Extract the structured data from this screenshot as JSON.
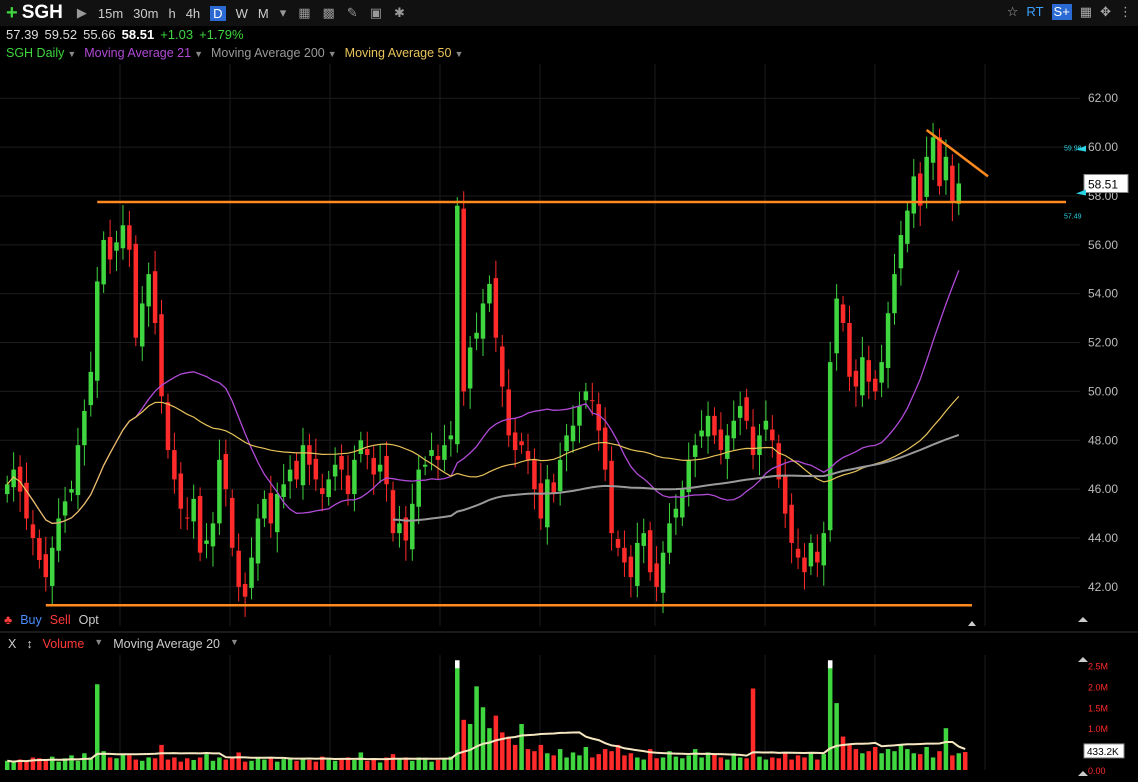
{
  "toolbar": {
    "symbol": "SGH",
    "timeframes": [
      "15m",
      "30m",
      "h",
      "4h",
      "D",
      "W",
      "M"
    ],
    "active_timeframe": "D",
    "right_icons": [
      "star-icon",
      "rt-icon",
      "share-icon",
      "save-icon",
      "move-icon",
      "more-icon"
    ],
    "rt_label": "RT",
    "share_label": "S+"
  },
  "quote": {
    "open": "57.39",
    "high": "59.52",
    "low": "55.66",
    "last": "58.51",
    "change": "+1.03",
    "change_pct": "+1.79%"
  },
  "legend": {
    "items": [
      {
        "label": "SGH Daily",
        "color": "#3fd63f"
      },
      {
        "label": "Moving Average 21",
        "color": "#b04ad6"
      },
      {
        "label": "Moving Average 200",
        "color": "#9a9a9a"
      },
      {
        "label": "Moving Average 50",
        "color": "#e8c35a"
      }
    ]
  },
  "trade": {
    "buy": "Buy",
    "sell": "Sell",
    "opt": "Opt"
  },
  "volume_legend": {
    "close": "X",
    "volume": "Volume",
    "ma": "Moving Average 20"
  },
  "colors": {
    "up": "#3fd63f",
    "down": "#ff2a2a",
    "trendline": "#ff8a1e",
    "grid": "#1c1c1c",
    "axis_text": "#bbbbbb"
  },
  "chart_data": {
    "type": "candlestick",
    "price_axis": {
      "ticks": [
        "42.00",
        "44.00",
        "46.00",
        "48.00",
        "50.00",
        "52.00",
        "54.00",
        "56.00",
        "58.00",
        "60.00",
        "62.00"
      ],
      "ylim": [
        40.4,
        63.4
      ]
    },
    "last_price_label": "58.51",
    "alert_high_label": "59.98",
    "alert_low_label": "57.49",
    "horizontal_lines": [
      57.75,
      41.25
    ],
    "descending_trendline": {
      "from": 60.7,
      "to": 58.8
    },
    "volume_axis": {
      "ticks": [
        "2.5M",
        "2.0M",
        "1.5M",
        "1.0M",
        "0.00"
      ],
      "last_label": "433.2K",
      "ylim_M": [
        0,
        2.75
      ]
    },
    "closes": [
      46.2,
      46.8,
      45.9,
      44.8,
      44.0,
      43.1,
      42.4,
      43.6,
      44.8,
      45.5,
      46.0,
      47.8,
      49.2,
      50.8,
      54.5,
      56.2,
      55.4,
      56.1,
      56.8,
      55.8,
      52.2,
      53.6,
      54.8,
      52.8,
      49.8,
      47.6,
      46.4,
      45.2,
      44.8,
      45.6,
      43.4,
      43.9,
      44.6,
      47.2,
      46.0,
      43.6,
      42.0,
      41.6,
      43.2,
      44.8,
      45.6,
      44.6,
      45.8,
      46.2,
      46.8,
      46.4,
      47.8,
      47.0,
      46.4,
      45.8,
      46.4,
      47.0,
      46.8,
      45.8,
      47.2,
      48.0,
      47.4,
      46.6,
      47.0,
      46.2,
      44.2,
      44.6,
      43.9,
      45.4,
      46.8,
      47.0,
      47.6,
      47.2,
      47.8,
      48.2,
      57.6,
      50.0,
      51.8,
      52.4,
      53.6,
      54.4,
      52.2,
      50.2,
      48.2,
      47.6,
      47.8,
      47.2,
      46.0,
      44.8,
      46.4,
      45.8,
      47.2,
      48.2,
      48.6,
      49.4,
      50.0,
      49.6,
      48.4,
      46.8,
      44.2,
      43.6,
      43.0,
      42.4,
      43.8,
      44.2,
      42.6,
      42.0,
      43.4,
      44.6,
      45.2,
      46.0,
      47.2,
      47.8,
      48.4,
      49.0,
      48.2,
      47.6,
      48.2,
      48.8,
      49.4,
      48.8,
      47.4,
      48.2,
      48.8,
      48.0,
      46.4,
      45.0,
      43.8,
      43.2,
      42.6,
      43.8,
      43.0,
      44.2,
      51.2,
      53.8,
      52.8,
      50.6,
      50.2,
      51.4,
      50.4,
      50.0,
      51.2,
      53.2,
      54.8,
      56.4,
      57.4,
      58.8,
      57.6,
      59.6,
      60.4,
      58.4,
      59.6,
      57.8,
      58.51
    ],
    "volumes_M": [
      0.22,
      0.18,
      0.25,
      0.2,
      0.3,
      0.28,
      0.24,
      0.32,
      0.2,
      0.28,
      0.35,
      0.22,
      0.4,
      0.3,
      2.05,
      0.45,
      0.3,
      0.28,
      0.38,
      0.35,
      0.25,
      0.22,
      0.3,
      0.28,
      0.6,
      0.25,
      0.3,
      0.2,
      0.28,
      0.24,
      0.3,
      0.38,
      0.22,
      0.3,
      0.25,
      0.32,
      0.42,
      0.2,
      0.22,
      0.3,
      0.25,
      0.3,
      0.2,
      0.26,
      0.3,
      0.22,
      0.28,
      0.24,
      0.2,
      0.32,
      0.25,
      0.22,
      0.28,
      0.3,
      0.24,
      0.42,
      0.22,
      0.25,
      0.18,
      0.3,
      0.38,
      0.28,
      0.3,
      0.22,
      0.3,
      0.25,
      0.2,
      0.24,
      0.28,
      0.32,
      2.6,
      1.2,
      1.1,
      2.0,
      1.5,
      1.0,
      1.3,
      0.9,
      0.8,
      0.6,
      1.1,
      0.5,
      0.45,
      0.6,
      0.4,
      0.35,
      0.5,
      0.3,
      0.42,
      0.35,
      0.55,
      0.3,
      0.38,
      0.5,
      0.45,
      0.6,
      0.35,
      0.4,
      0.3,
      0.25,
      0.5,
      0.28,
      0.3,
      0.45,
      0.32,
      0.28,
      0.35,
      0.5,
      0.3,
      0.42,
      0.36,
      0.3,
      0.25,
      0.4,
      0.3,
      0.28,
      1.95,
      0.32,
      0.25,
      0.3,
      0.28,
      0.4,
      0.25,
      0.35,
      0.3,
      0.42,
      0.25,
      0.38,
      2.6,
      1.6,
      0.8,
      0.6,
      0.5,
      0.4,
      0.45,
      0.55,
      0.4,
      0.5,
      0.45,
      0.6,
      0.5,
      0.4,
      0.38,
      0.55,
      0.3,
      0.45,
      1.0,
      0.35,
      0.4,
      0.43
    ]
  }
}
